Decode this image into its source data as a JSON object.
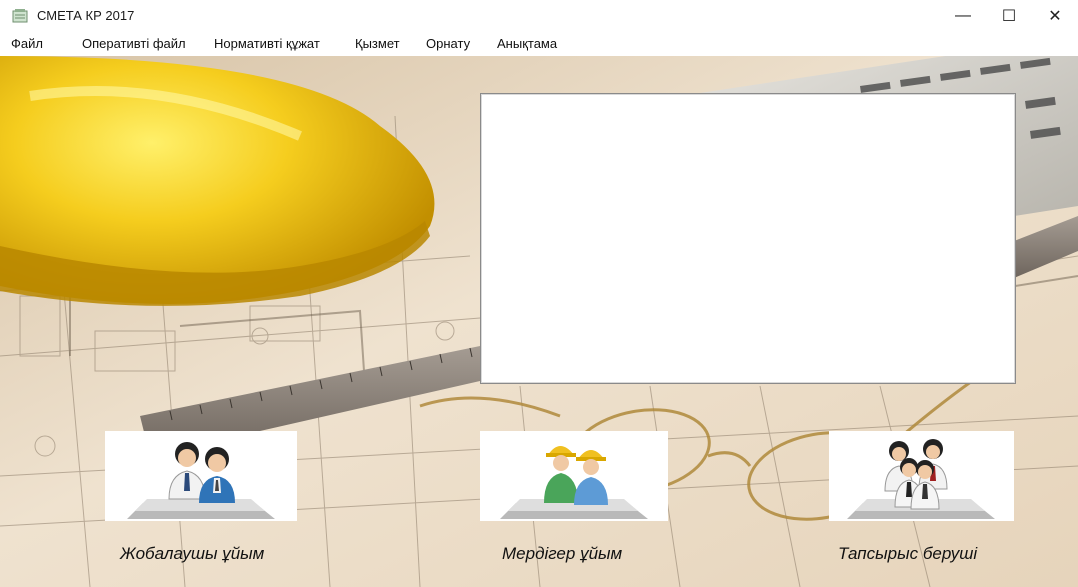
{
  "window": {
    "title": "СМЕТА КР 2017"
  },
  "controls": {
    "minimize": "—",
    "maximize": "☐",
    "close": "✕"
  },
  "menu": [
    {
      "label": "Файл"
    },
    {
      "label": "Оперативті файл"
    },
    {
      "label": "Нормативті құжат"
    },
    {
      "label": "Қызмет"
    },
    {
      "label": "Орнату"
    },
    {
      "label": "Анықтама"
    }
  ],
  "tiles": [
    {
      "label": "Жобалаушы ұйым",
      "icon": "designers-icon"
    },
    {
      "label": "Мердігер ұйым",
      "icon": "contractors-icon"
    },
    {
      "label": "Тапсырыс беруші",
      "icon": "customers-icon"
    }
  ],
  "colors": {
    "helmet": "#f2c21b",
    "blueprint": "#eadbc6",
    "ruler": "#8a7f74"
  }
}
